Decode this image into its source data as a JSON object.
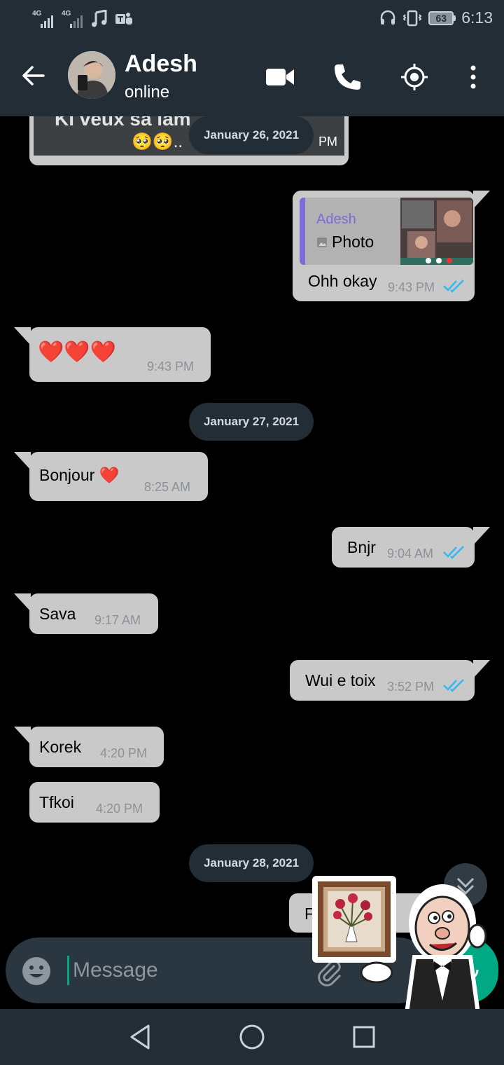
{
  "status_bar": {
    "signal1_label": "4G",
    "signal2_label": "4G",
    "battery_level": "63",
    "time": "6:13"
  },
  "header": {
    "contact_name": "Adesh",
    "contact_status": "online",
    "icons": [
      "back-arrow-icon",
      "video-call-icon",
      "phone-call-icon",
      "location-icon",
      "more-vertical-icon"
    ]
  },
  "chat": {
    "top_partial_message": {
      "text": "Ki veux sa lam",
      "emoji": "🥺🥺..",
      "time_partial": "PM"
    },
    "dates": [
      "January 26, 2021",
      "January 27, 2021",
      "January 28, 2021"
    ],
    "reply_message": {
      "quoted_author": "Adesh",
      "quoted_type": "Photo",
      "text": "Ohh okay",
      "time": "9:43 PM"
    },
    "messages": [
      {
        "id": "hearts",
        "direction": "in",
        "text": "❤️❤️❤️",
        "time": "9:43 PM"
      },
      {
        "id": "bonjour",
        "direction": "in",
        "text": "Bonjour ❤️",
        "time": "8:25 AM"
      },
      {
        "id": "bnjr",
        "direction": "out",
        "text": "Bnjr",
        "time": "9:04 AM"
      },
      {
        "id": "sava",
        "direction": "in",
        "text": "Sava",
        "time": "9:17 AM"
      },
      {
        "id": "wui",
        "direction": "out",
        "text": "Wui e toix",
        "time": "3:52 PM"
      },
      {
        "id": "korek",
        "direction": "in",
        "text": "Korek",
        "time": "4:20 PM"
      },
      {
        "id": "tfkoi",
        "direction": "in",
        "text": "Tfkoi",
        "time": "4:20 PM"
      },
      {
        "id": "partial",
        "direction": "out",
        "text": "F",
        "time": ""
      }
    ]
  },
  "input": {
    "placeholder": "Message"
  },
  "colors": {
    "bar_bg": "#232d36",
    "bubble_bg": "#c9c9c9",
    "read_ticks": "#34b7f1",
    "accent": "#00a884",
    "quote_bar": "#7c6cd6"
  }
}
